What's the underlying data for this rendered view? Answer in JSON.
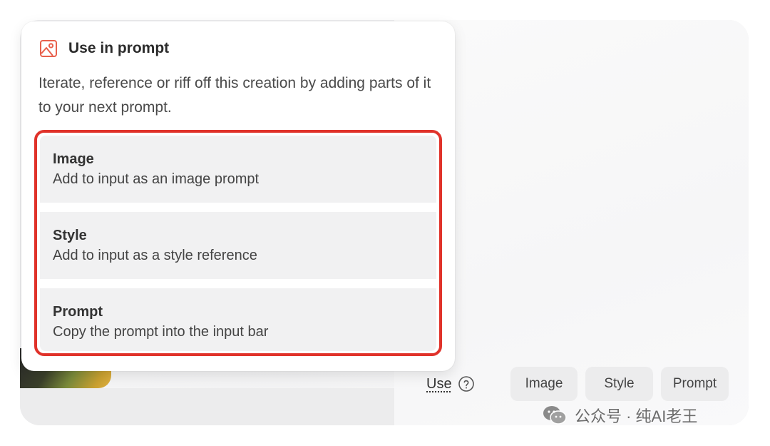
{
  "popover": {
    "title": "Use in prompt",
    "description": "Iterate, reference or riff off this creation by adding parts of it to your next prompt.",
    "options": [
      {
        "title": "Image",
        "subtitle": "Add to input as an image prompt"
      },
      {
        "title": "Style",
        "subtitle": "Add to input as a style reference"
      },
      {
        "title": "Prompt",
        "subtitle": "Copy the prompt into the input bar"
      }
    ]
  },
  "toolbar": {
    "use_label": "Use",
    "buttons": [
      "Image",
      "Style",
      "Prompt"
    ]
  },
  "watermark": {
    "text": "公众号 · 纯AI老王"
  },
  "colors": {
    "highlight_border": "#e0322a",
    "icon_accent": "#e8604c",
    "option_bg": "#f1f1f2",
    "chip_bg": "#ececed"
  },
  "icons": {
    "header": "image-icon",
    "help": "question-circle-icon",
    "watermark": "wechat-icon"
  }
}
